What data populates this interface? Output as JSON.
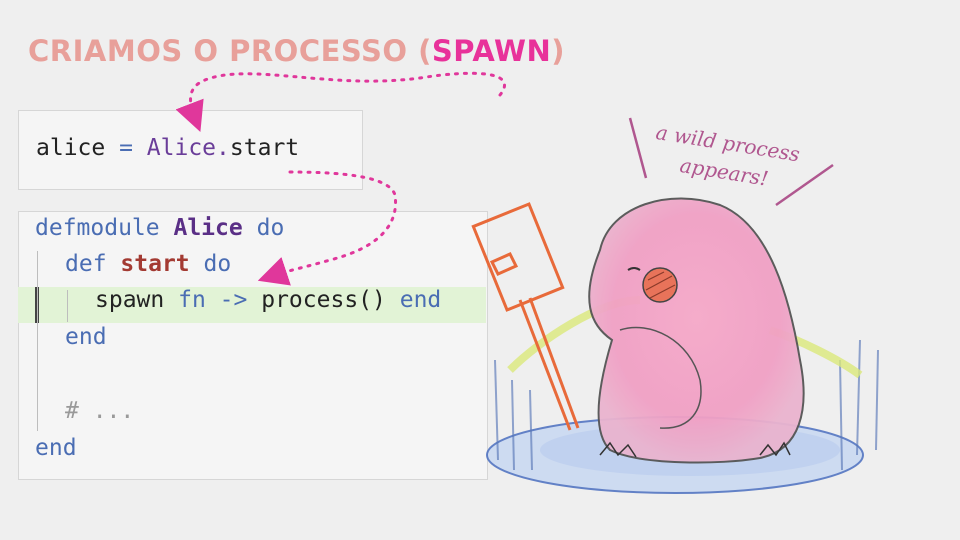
{
  "title": {
    "prefix": "CRIAMOS O PROCESSO (",
    "highlight": "SPAWN",
    "suffix": ")"
  },
  "snippet1": {
    "var": "alice",
    "op": " = ",
    "module": "Alice",
    "dot": ".",
    "func": "start"
  },
  "snippet2": {
    "defmodule": "defmodule",
    "module_name": "Alice",
    "do1": "do",
    "def": "def",
    "func_name": "start",
    "do2": "do",
    "spawn": "spawn",
    "fn": "fn",
    "arrow": "->",
    "process_call": "process()",
    "end_inline": "end",
    "end1": "end",
    "comment": "# ...",
    "end2": "end"
  },
  "illustration": {
    "caption_line1": "a wild process",
    "caption_line2": "appears!"
  },
  "colors": {
    "title": "#e8a09a",
    "accent": "#e8329a",
    "keyword": "#4a6db3",
    "module": "#6a3d99",
    "function": "#a33a32",
    "highlight_row": "#e2f3d6"
  }
}
